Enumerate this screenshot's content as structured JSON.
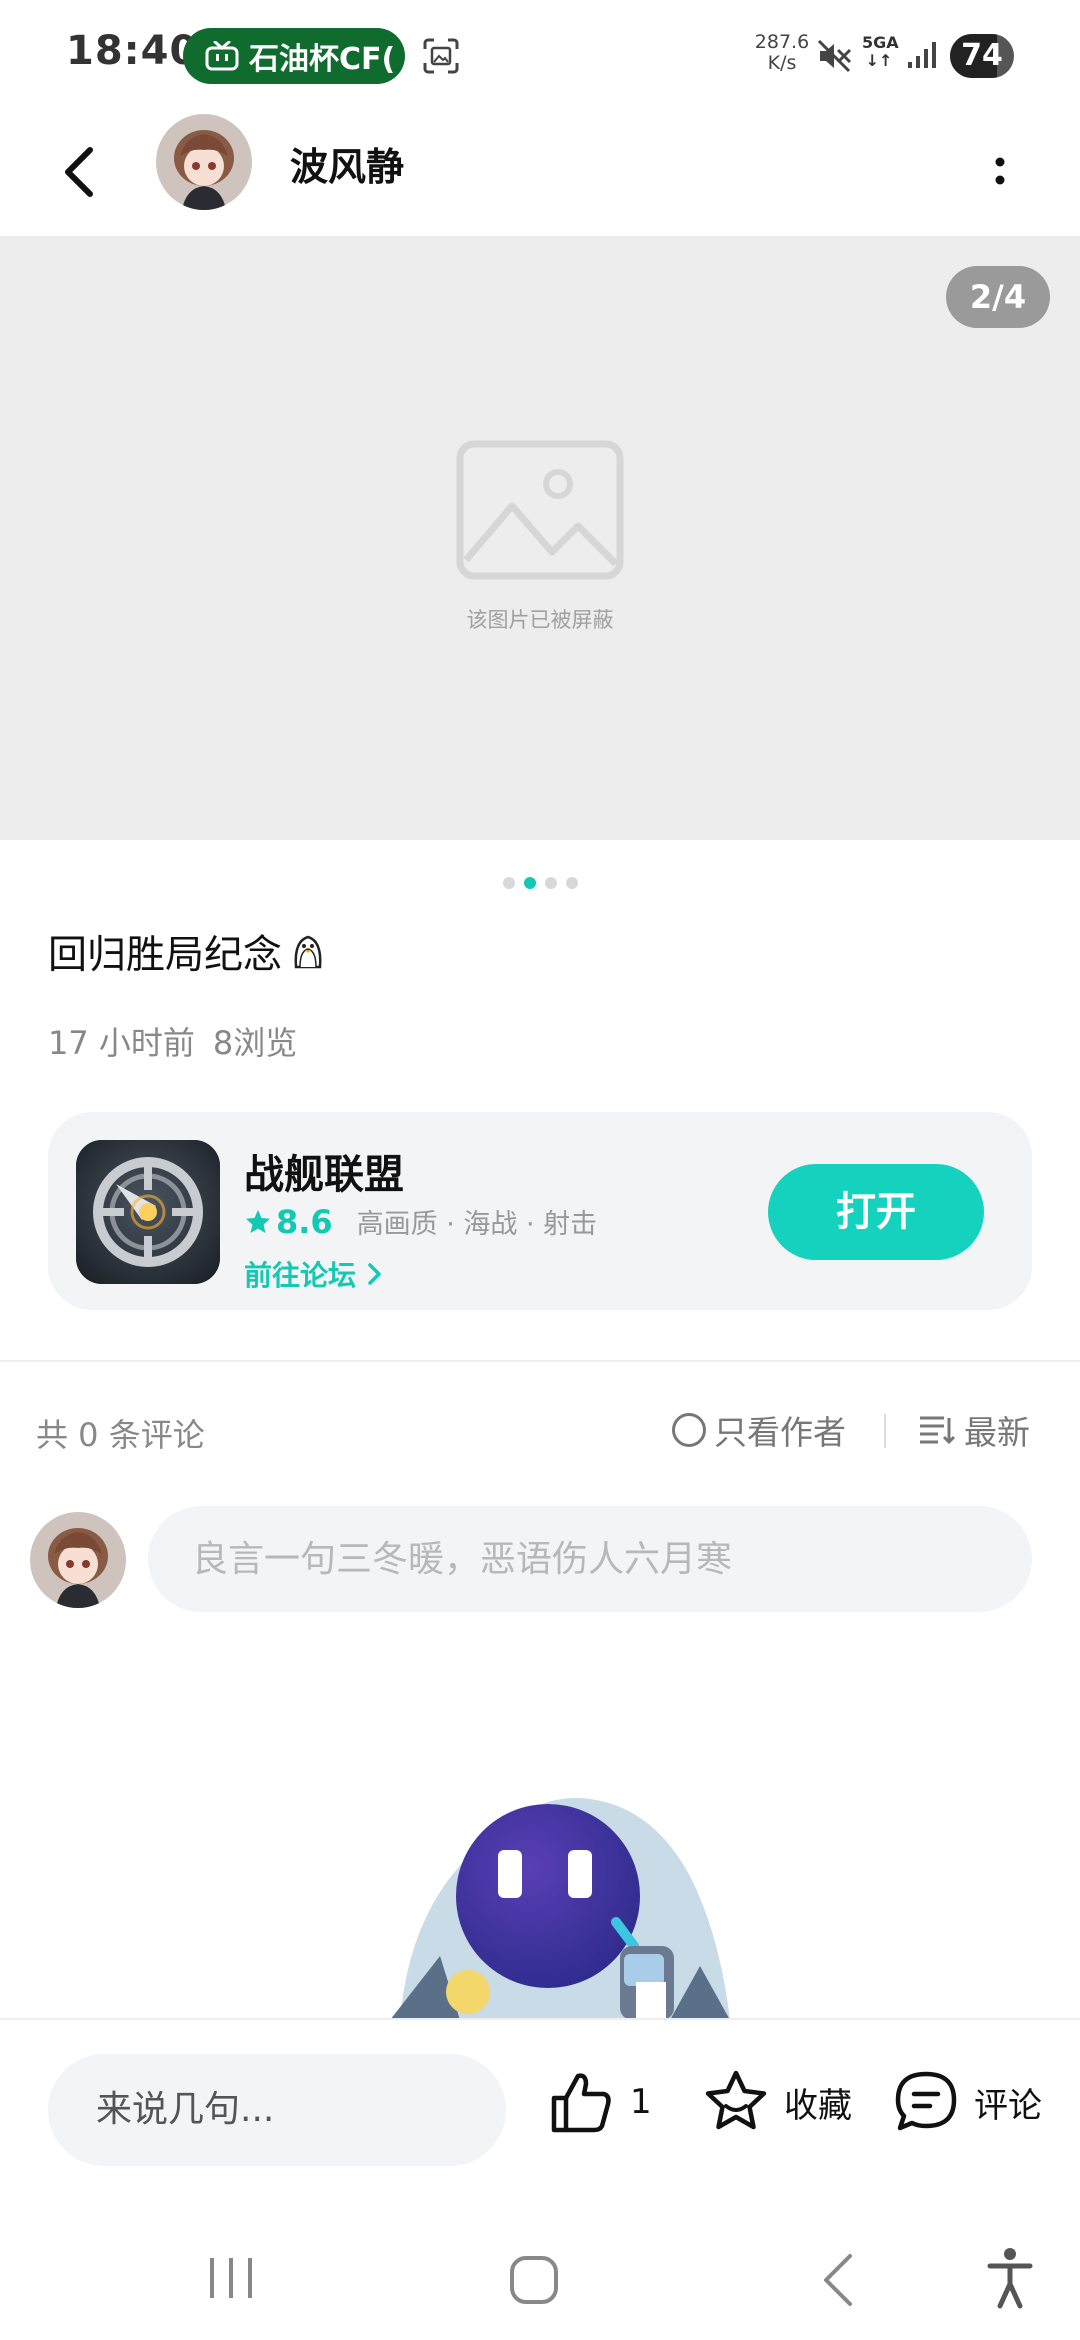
{
  "status_bar": {
    "time": "18:40",
    "live_pill_text": "石油杯CF(",
    "net_speed_value": "287.6",
    "net_speed_unit": "K/s",
    "network_type": "5GA",
    "battery_level": "74"
  },
  "header": {
    "author_name": "波风静"
  },
  "image_viewer": {
    "page_indicator": "2/4",
    "blocked_text": "该图片已被屏蔽",
    "current_page": 2,
    "total_pages": 4
  },
  "post": {
    "title": "回归胜局纪念",
    "time_ago": "17 小时前",
    "views": "8浏览"
  },
  "app_card": {
    "name": "战舰联盟",
    "rating": "8.6",
    "tags": "高画质 · 海战 · 射击",
    "forum_link": "前往论坛",
    "open_button": "打开"
  },
  "comments": {
    "count_label": "共 0 条评论",
    "author_only_label": "只看作者",
    "sort_label": "最新",
    "input_placeholder": "良言一句三冬暖，恶语伤人六月寒"
  },
  "bottom_bar": {
    "say_placeholder": "来说几句...",
    "like_count": "1",
    "favorite_label": "收藏",
    "comment_label": "评论"
  },
  "colors": {
    "accent": "#14c9b4",
    "open_button": "#14d2bd",
    "live_pill": "#0f6b2e",
    "image_placeholder_bg": "#ededed",
    "card_bg": "#f3f4f6"
  },
  "icons": [
    "back-arrow-icon",
    "more-vertical-icon",
    "image-placeholder-icon",
    "star-icon",
    "chevron-right-icon",
    "sort-icon",
    "thumbs-up-icon",
    "favorite-star-icon",
    "comment-bubble-icon",
    "recents-icon",
    "home-icon",
    "back-nav-icon",
    "accessibility-icon"
  ]
}
